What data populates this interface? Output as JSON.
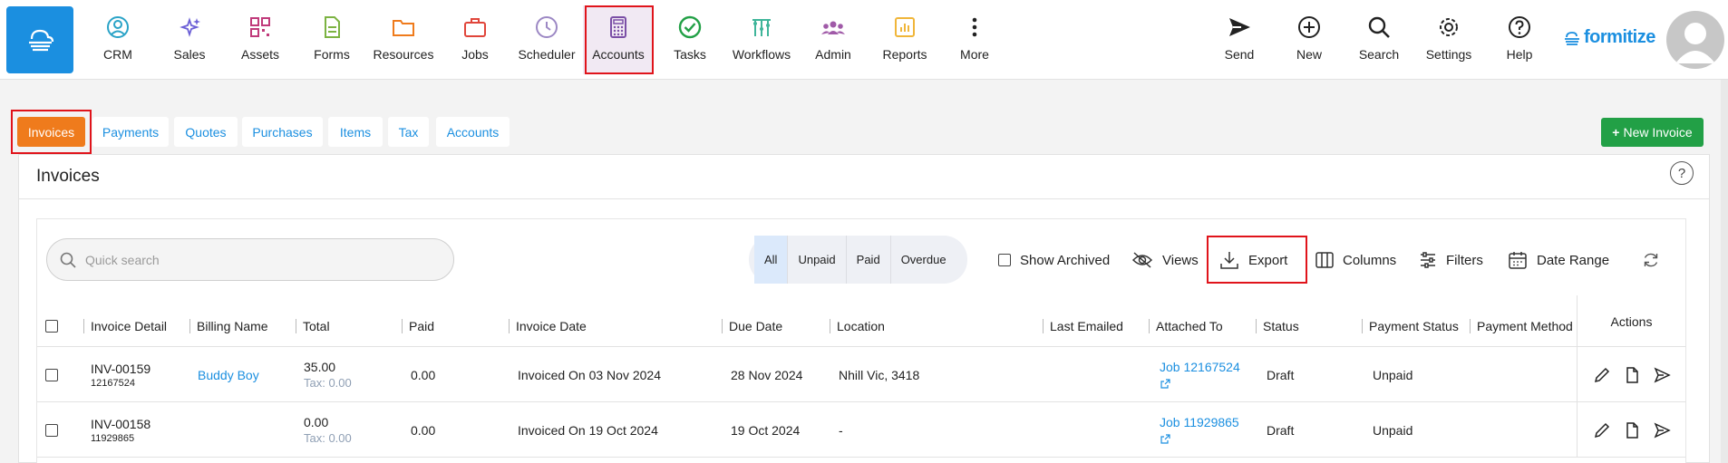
{
  "nav": {
    "items": [
      {
        "label": "CRM",
        "icon": "crm-icon"
      },
      {
        "label": "Sales",
        "icon": "sales-icon"
      },
      {
        "label": "Assets",
        "icon": "assets-icon"
      },
      {
        "label": "Forms",
        "icon": "forms-icon"
      },
      {
        "label": "Resources",
        "icon": "resources-icon"
      },
      {
        "label": "Jobs",
        "icon": "jobs-icon"
      },
      {
        "label": "Scheduler",
        "icon": "scheduler-icon"
      },
      {
        "label": "Accounts",
        "icon": "accounts-icon"
      },
      {
        "label": "Tasks",
        "icon": "tasks-icon"
      },
      {
        "label": "Workflows",
        "icon": "workflows-icon"
      },
      {
        "label": "Admin",
        "icon": "admin-icon"
      },
      {
        "label": "Reports",
        "icon": "reports-icon"
      },
      {
        "label": "More",
        "icon": "more-icon"
      }
    ],
    "right_items": [
      {
        "label": "Send",
        "icon": "send-icon"
      },
      {
        "label": "New",
        "icon": "new-icon"
      },
      {
        "label": "Search",
        "icon": "search-icon"
      },
      {
        "label": "Settings",
        "icon": "settings-icon"
      },
      {
        "label": "Help",
        "icon": "help-icon"
      }
    ],
    "brand": "formitize",
    "active": "Accounts",
    "colors": {
      "accent": "#1b8fe0",
      "highlight": "#e0141b"
    }
  },
  "tabs": [
    "Invoices",
    "Payments",
    "Quotes",
    "Purchases",
    "Items",
    "Tax",
    "Accounts"
  ],
  "active_tab": "Invoices",
  "new_button": "New Invoice",
  "page_title": "Invoices",
  "search_placeholder": "Quick search",
  "status_filter": {
    "options": [
      "All",
      "Unpaid",
      "Paid",
      "Overdue"
    ],
    "selected": "All"
  },
  "toolbar": {
    "show_archived": "Show Archived",
    "views": "Views",
    "export": "Export",
    "columns": "Columns",
    "filters": "Filters",
    "date_range": "Date Range"
  },
  "columns": [
    "Invoice Detail",
    "Billing Name",
    "Total",
    "Paid",
    "Invoice Date",
    "Due Date",
    "Location",
    "Last Emailed",
    "Attached To",
    "Status",
    "Payment Status",
    "Payment Method",
    "Actions"
  ],
  "rows": [
    {
      "invoice": "INV-00159",
      "number": "12167524",
      "billing": "Buddy Boy",
      "total": "35.00",
      "tax": "Tax: 0.00",
      "paid": "0.00",
      "invoice_date": "Invoiced On 03 Nov 2024",
      "due_date": "28 Nov 2024",
      "location": "Nhill Vic, 3418",
      "last_emailed": "",
      "attached": "Job 12167524",
      "status": "Draft",
      "payment_status": "Unpaid",
      "payment_method": ""
    },
    {
      "invoice": "INV-00158",
      "number": "11929865",
      "billing": "",
      "total": "0.00",
      "tax": "Tax: 0.00",
      "paid": "0.00",
      "invoice_date": "Invoiced On 19 Oct 2024",
      "due_date": "19 Oct 2024",
      "location": "-",
      "last_emailed": "",
      "attached": "Job 11929865",
      "status": "Draft",
      "payment_status": "Unpaid",
      "payment_method": ""
    }
  ]
}
